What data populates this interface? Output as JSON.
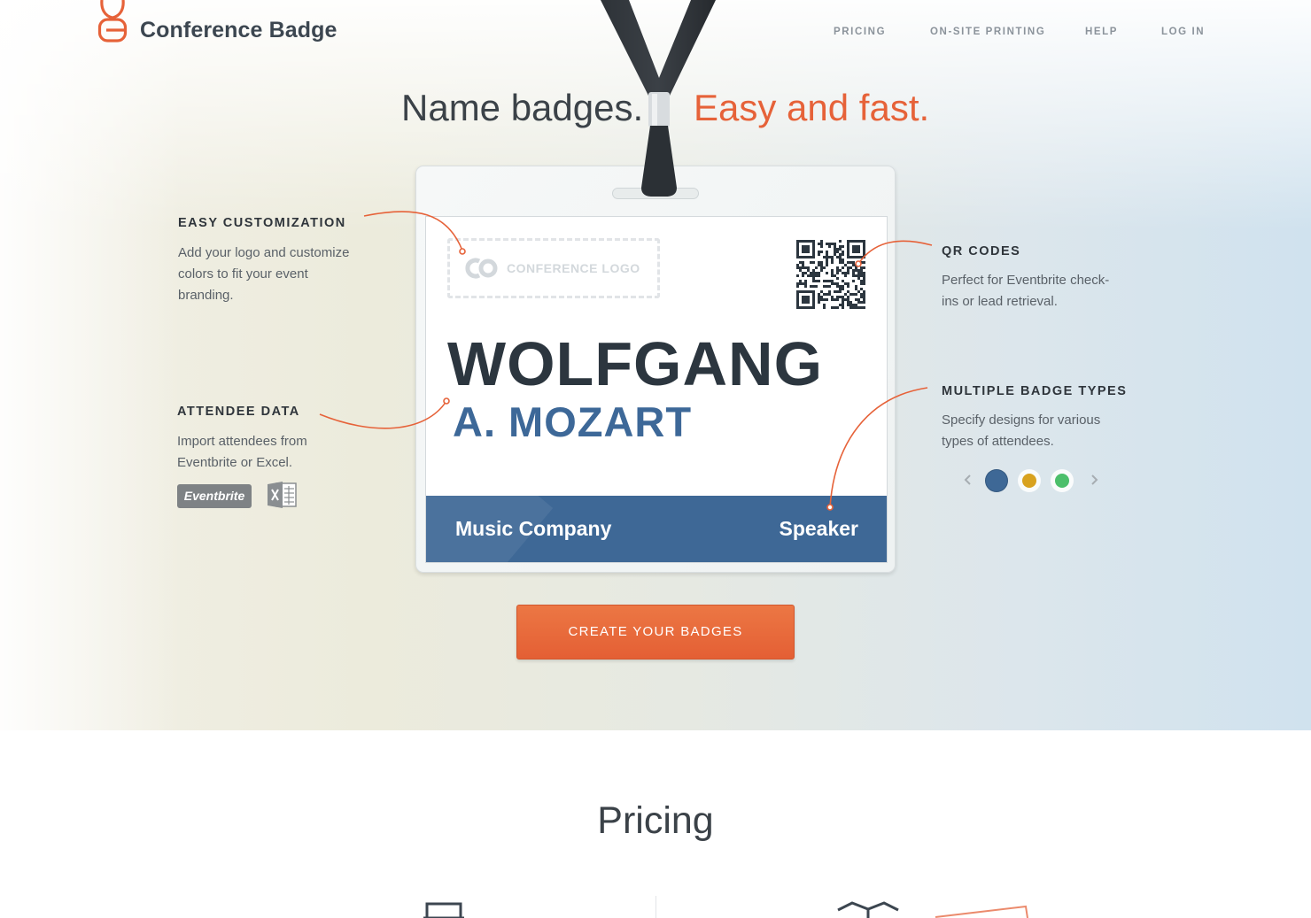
{
  "header": {
    "brand": "Conference Badge",
    "nav": [
      "PRICING",
      "ON-SITE PRINTING",
      "HELP",
      "LOG IN"
    ]
  },
  "hero": {
    "headline_left": "Name badges.",
    "headline_right": "Easy and fast."
  },
  "badge": {
    "logo_placeholder": "CONFERENCE LOGO",
    "first_name": "WOLFGANG",
    "last_name": "A. MOZART",
    "company": "Music Company",
    "role": "Speaker"
  },
  "features": [
    {
      "title": "EASY CUSTOMIZATION",
      "desc": "Add your logo and customize colors to fit your event branding."
    },
    {
      "title": "ATTENDEE DATA",
      "desc": "Import attendees from Eventbrite or Excel."
    },
    {
      "title": "QR CODES",
      "desc": "Perfect for Eventbrite check-ins or lead retrieval."
    },
    {
      "title": "MULTIPLE BADGE TYPES",
      "desc": "Specify designs for various types of attendees."
    }
  ],
  "integrations": {
    "eventbrite": "Eventbrite"
  },
  "badge_types": {
    "colors": [
      "#3e6896",
      "#d8a21f",
      "#4cbf6b"
    ],
    "selected_index": 0
  },
  "cta": "CREATE YOUR BADGES",
  "pricing": {
    "title": "Pricing"
  },
  "icons": [
    "badge-logo-icon",
    "conference-logo-mark-icon",
    "qr-code-icon",
    "excel-icon",
    "chevron-left-icon",
    "chevron-right-icon",
    "monitor-icon",
    "box-icon"
  ],
  "colors": {
    "accent": "#e66239",
    "badge_blue": "#3e6896",
    "text_dark": "#2c363f",
    "nav_gray": "#8b939b"
  }
}
